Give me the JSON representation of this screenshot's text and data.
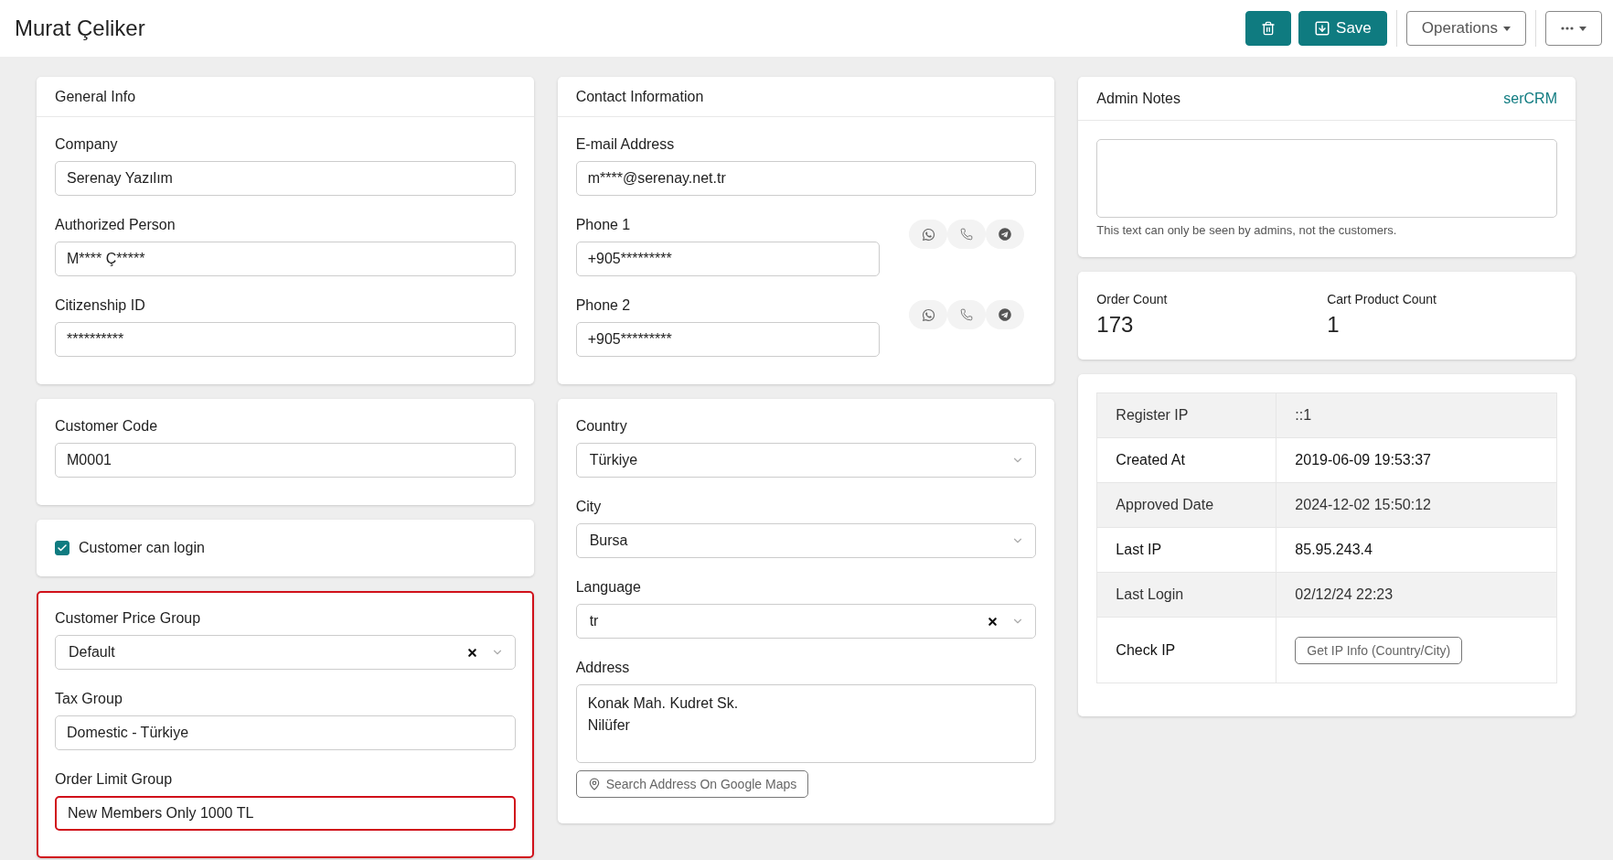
{
  "header": {
    "title": "Murat Çeliker",
    "buttons": [
      {
        "kind": "delete"
      },
      {
        "kind": "save",
        "label": "Save"
      },
      {
        "kind": "dropdown",
        "label": "Operations"
      },
      {
        "kind": "more"
      }
    ]
  },
  "columns": [
    {
      "cards": [
        {
          "kind": "form",
          "title": "General Info",
          "highlighted": false,
          "fields": [
            {
              "kind": "text",
              "label": "Company",
              "value": "Serenay Yazılım"
            },
            {
              "kind": "text",
              "label": "Authorized Person",
              "value": "M**** Ç*****"
            },
            {
              "kind": "text",
              "label": "Citizenship ID",
              "value": "**********"
            }
          ]
        },
        {
          "kind": "form",
          "highlighted": false,
          "fields": [
            {
              "kind": "text",
              "label": "Customer Code",
              "value": "M0001"
            }
          ]
        },
        {
          "kind": "checkbox",
          "label": "Customer can login",
          "checked": true
        },
        {
          "kind": "form",
          "highlighted": true,
          "fields": [
            {
              "kind": "select",
              "label": "Customer Price Group",
              "value": "Default",
              "clearable": true
            },
            {
              "kind": "text",
              "label": "Tax Group",
              "value": "Domestic - Türkiye"
            },
            {
              "kind": "text",
              "label": "Order Limit Group",
              "value": "New Members Only 1000 TL",
              "invalid": true
            }
          ]
        }
      ]
    },
    {
      "cards": [
        {
          "kind": "form",
          "title": "Contact Information",
          "highlighted": false,
          "fields": [
            {
              "kind": "text",
              "label": "E-mail Address",
              "value": "m****@serenay.net.tr"
            },
            {
              "kind": "phone",
              "label": "Phone 1",
              "value": "+905*********",
              "actions": [
                {
                  "kind": "whatsapp"
                },
                {
                  "kind": "call"
                },
                {
                  "kind": "telegram"
                }
              ]
            },
            {
              "kind": "phone",
              "label": "Phone 2",
              "value": "+905*********",
              "actions": [
                {
                  "kind": "whatsapp"
                },
                {
                  "kind": "call"
                },
                {
                  "kind": "telegram"
                }
              ]
            }
          ]
        },
        {
          "kind": "form",
          "highlighted": false,
          "fields": [
            {
              "kind": "select",
              "label": "Country",
              "value": "Türkiye"
            },
            {
              "kind": "select",
              "label": "City",
              "value": "Bursa"
            },
            {
              "kind": "select",
              "label": "Language",
              "value": "tr",
              "clearable": true
            },
            {
              "kind": "textarea",
              "label": "Address",
              "value": "Konak Mah. Kudret Sk.\nNilüfer"
            }
          ],
          "link_button": "Search Address On Google Maps"
        }
      ]
    },
    {
      "cards": [
        {
          "kind": "notes",
          "title": "Admin Notes",
          "brand": "serCRM",
          "hint": "This text can only be seen by admins, not the customers."
        },
        {
          "kind": "stats",
          "items": [
            {
              "label": "Order Count",
              "value": "173"
            },
            {
              "label": "Cart Product Count",
              "value": "1"
            }
          ]
        },
        {
          "kind": "table",
          "rows": [
            {
              "label": "Register IP",
              "value": "::1"
            },
            {
              "label": "Created At",
              "value": "2019-06-09 19:53:37"
            },
            {
              "label": "Approved Date",
              "value": "2024-12-02 15:50:12"
            },
            {
              "label": "Last IP",
              "value": "85.95.243.4"
            },
            {
              "label": "Last Login",
              "value": "02/12/24 22:23"
            },
            {
              "label": "Check IP",
              "button": "Get IP Info (Country/City)"
            }
          ]
        }
      ]
    }
  ]
}
